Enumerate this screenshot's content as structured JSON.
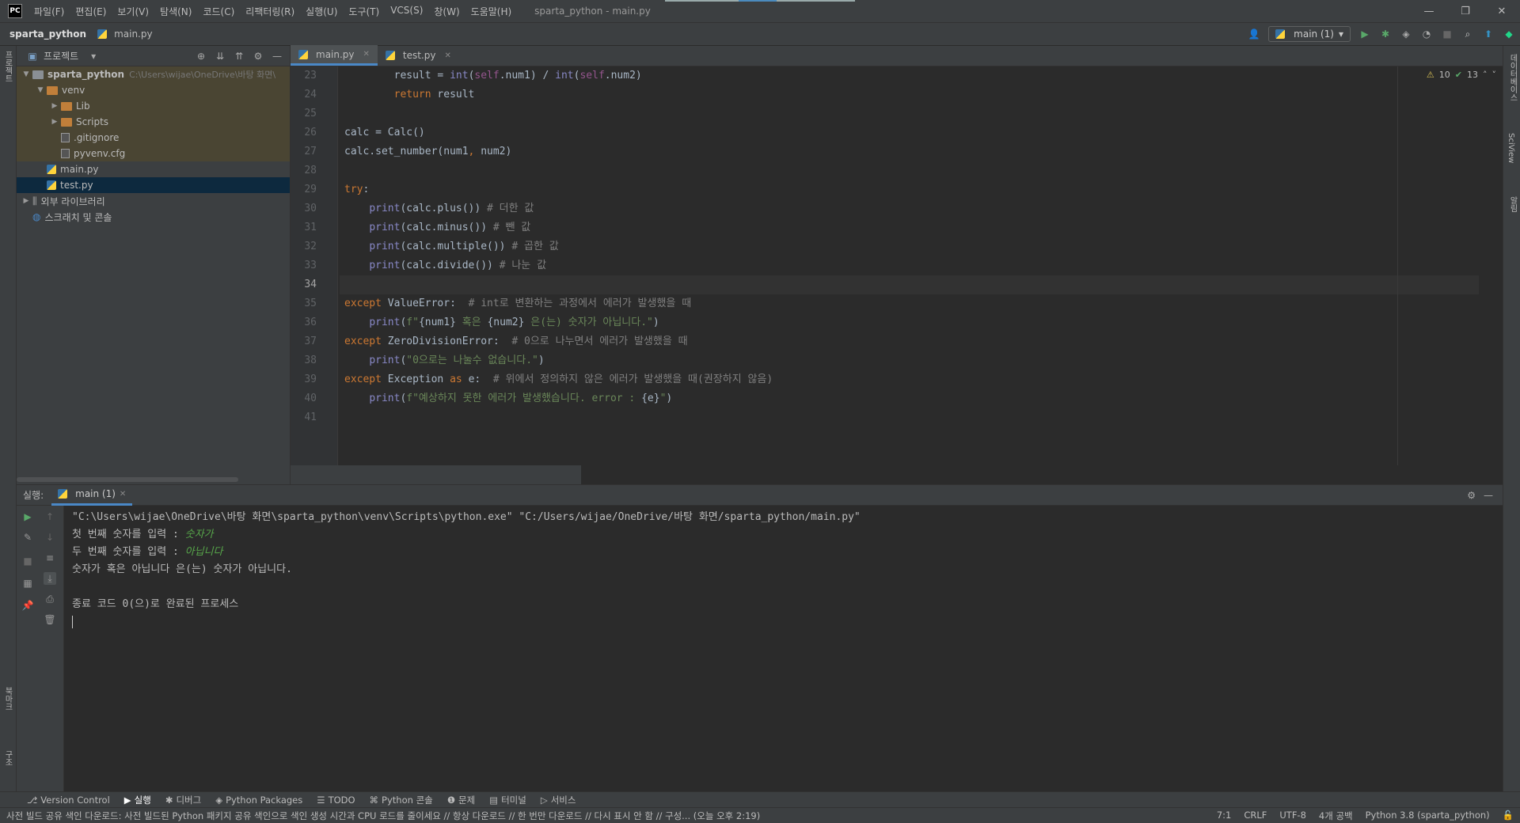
{
  "app": {
    "logo": "PC",
    "window_title": "sparta_python - main.py"
  },
  "menu": [
    "파일(F)",
    "편집(E)",
    "보기(V)",
    "탐색(N)",
    "코드(C)",
    "리팩터링(R)",
    "실행(U)",
    "도구(T)",
    "VCS(S)",
    "창(W)",
    "도움말(H)"
  ],
  "window_controls": [
    "—",
    "❐",
    "✕"
  ],
  "nav": {
    "project": "sparta_python",
    "file": "main.py",
    "run_config": "main (1)"
  },
  "left_strip": {
    "project": "프로젝트",
    "bookmarks": "북마크",
    "structure": "구조"
  },
  "right_strip": {
    "database": "데이터베이스",
    "sciview": "SciView",
    "notifications": "알림"
  },
  "project_panel": {
    "title": "프로젝트",
    "tree": [
      {
        "label": "sparta_python",
        "path": "C:\\Users\\wijae\\OneDrive\\바탕 화면\\",
        "type": "root",
        "depth": 0,
        "expanded": true
      },
      {
        "label": "venv",
        "type": "folder",
        "depth": 1,
        "expanded": true
      },
      {
        "label": "Lib",
        "type": "folder",
        "depth": 2,
        "expanded": false
      },
      {
        "label": "Scripts",
        "type": "folder",
        "depth": 2,
        "expanded": false
      },
      {
        "label": ".gitignore",
        "type": "file",
        "depth": 2
      },
      {
        "label": "pyvenv.cfg",
        "type": "file",
        "depth": 2
      },
      {
        "label": "main.py",
        "type": "py",
        "depth": 1
      },
      {
        "label": "test.py",
        "type": "py",
        "depth": 1,
        "selected": true
      },
      {
        "label": "외부 라이브러리",
        "type": "lib",
        "depth": 0,
        "expanded": false
      },
      {
        "label": "스크래치 및 콘솔",
        "type": "scratch",
        "depth": 0
      }
    ]
  },
  "editor": {
    "tabs": [
      {
        "label": "main.py",
        "active": true
      },
      {
        "label": "test.py",
        "active": false
      }
    ],
    "inspections": {
      "warnings": "10",
      "ok": "13"
    },
    "current_line": "34",
    "line_numbers": [
      "23",
      "24",
      "25",
      "26",
      "27",
      "28",
      "29",
      "30",
      "31",
      "32",
      "33",
      "34",
      "35",
      "36",
      "37",
      "38",
      "39",
      "40",
      "41"
    ],
    "lines": [
      [
        [
          "        ",
          ""
        ],
        [
          "result = ",
          ""
        ],
        [
          "int",
          "bi"
        ],
        [
          "(",
          ""
        ],
        [
          "self",
          "sf"
        ],
        [
          ".num1) / ",
          ""
        ],
        [
          "int",
          "bi"
        ],
        [
          "(",
          ""
        ],
        [
          "self",
          "sf"
        ],
        [
          ".num2)",
          ""
        ]
      ],
      [
        [
          "        ",
          ""
        ],
        [
          "return ",
          "kw"
        ],
        [
          "result",
          ""
        ]
      ],
      [],
      [
        [
          "calc = Calc()",
          ""
        ]
      ],
      [
        [
          "calc.set_number(num1",
          ""
        ],
        [
          ", ",
          "kw"
        ],
        [
          "num2)",
          ""
        ]
      ],
      [],
      [
        [
          "try",
          "kw"
        ],
        [
          ":",
          ""
        ]
      ],
      [
        [
          "    ",
          ""
        ],
        [
          "print",
          "bi"
        ],
        [
          "(calc.plus()) ",
          ""
        ],
        [
          "# 더한 값",
          "cm"
        ]
      ],
      [
        [
          "    ",
          ""
        ],
        [
          "print",
          "bi"
        ],
        [
          "(calc.minus()) ",
          ""
        ],
        [
          "# 뺀 값",
          "cm"
        ]
      ],
      [
        [
          "    ",
          ""
        ],
        [
          "print",
          "bi"
        ],
        [
          "(calc.multiple()) ",
          ""
        ],
        [
          "# 곱한 값",
          "cm"
        ]
      ],
      [
        [
          "    ",
          ""
        ],
        [
          "print",
          "bi"
        ],
        [
          "(calc.divide()) ",
          ""
        ],
        [
          "# 나눈 값",
          "cm"
        ]
      ],
      [],
      [
        [
          "except ",
          "kw"
        ],
        [
          "ValueError",
          ""
        ],
        [
          ":  ",
          ""
        ],
        [
          "# int로 변환하는 과정에서 에러가 발생했을 때",
          "cm"
        ]
      ],
      [
        [
          "    ",
          ""
        ],
        [
          "print",
          "bi"
        ],
        [
          "(",
          ""
        ],
        [
          "f\"",
          "st"
        ],
        [
          "{num1}",
          ""
        ],
        [
          " 혹은 ",
          "st"
        ],
        [
          "{num2}",
          ""
        ],
        [
          " 은(는) 숫자가 아닙니다.\"",
          "st"
        ],
        [
          ")",
          ""
        ]
      ],
      [
        [
          "except ",
          "kw"
        ],
        [
          "ZeroDivisionError",
          ""
        ],
        [
          ":  ",
          ""
        ],
        [
          "# 0으로 나누면서 에러가 발생했을 때",
          "cm"
        ]
      ],
      [
        [
          "    ",
          ""
        ],
        [
          "print",
          "bi"
        ],
        [
          "(",
          ""
        ],
        [
          "\"0으로는 나눌수 없습니다.\"",
          "st"
        ],
        [
          ")",
          ""
        ]
      ],
      [
        [
          "except ",
          "kw"
        ],
        [
          "Exception ",
          ""
        ],
        [
          "as ",
          "kw"
        ],
        [
          "e:  ",
          ""
        ],
        [
          "# 위에서 정의하지 않은 에러가 발생했을 때(권장하지 않음)",
          "cm"
        ]
      ],
      [
        [
          "    ",
          ""
        ],
        [
          "print",
          "bi"
        ],
        [
          "(",
          ""
        ],
        [
          "f\"예상하지 못한 에러가 발생했습니다. error : ",
          "st"
        ],
        [
          "{e}",
          ""
        ],
        [
          "\"",
          "st"
        ],
        [
          ")",
          ""
        ]
      ],
      []
    ]
  },
  "run_panel": {
    "label": "실행:",
    "tab": "main (1)",
    "output": [
      {
        "text": "\"C:\\Users\\wijae\\OneDrive\\바탕 화면\\sparta_python\\venv\\Scripts\\python.exe\" \"C:/Users/wijae/OneDrive/바탕 화면/sparta_python/main.py\""
      },
      {
        "text": "첫 번째 숫자를 입력 : ",
        "input": "숫자가"
      },
      {
        "text": "두 번째 숫자를 입력 : ",
        "input": "아닙니다"
      },
      {
        "text": "숫자가 혹은 아닙니다 은(는) 숫자가 아닙니다."
      },
      {
        "text": ""
      },
      {
        "text": "종료 코드 0(으)로 완료된 프로세스"
      }
    ]
  },
  "bottom_tools": [
    "Version Control",
    "실행",
    "디버그",
    "Python Packages",
    "TODO",
    "Python 콘솔",
    "문제",
    "터미널",
    "서비스"
  ],
  "status": {
    "message": "사전 빌드 공유 색인 다운로드: 사전 빌드된 Python 패키지 공유 색인으로 색인 생성 시간과 CPU 로드를 줄이세요 // 항상 다운로드 // 한 번만 다운로드 // 다시 표시 안 함 // 구성... (오늘 오후 2:19)",
    "position": "7:1",
    "line_sep": "CRLF",
    "encoding": "UTF-8",
    "indent": "4개 공백",
    "interpreter": "Python 3.8 (sparta_python)"
  }
}
